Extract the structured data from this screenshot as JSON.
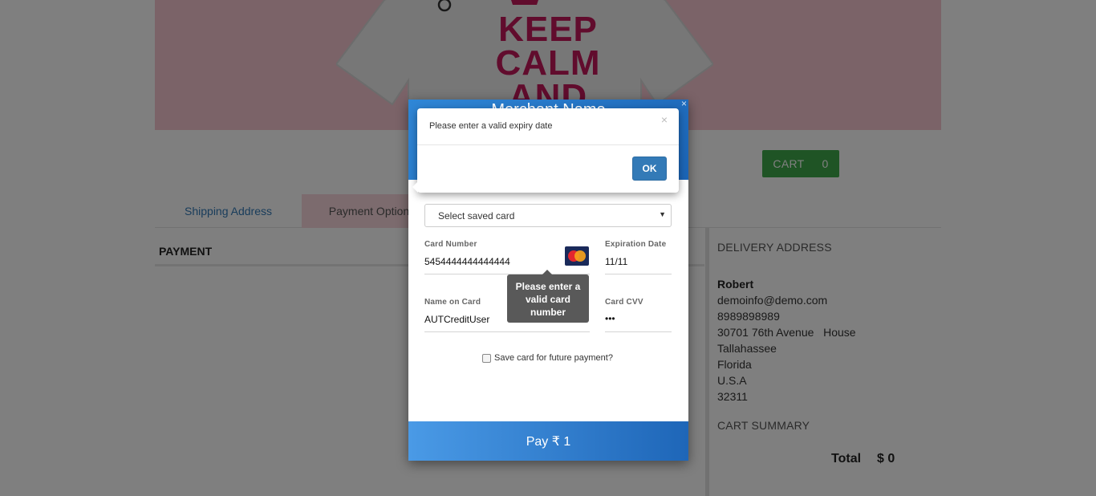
{
  "hero": {
    "shirt_text": [
      "KEEP",
      "CALM",
      "AND"
    ]
  },
  "cart": {
    "label": "CART",
    "count": "0"
  },
  "tabs": [
    {
      "label": "Shipping Address"
    },
    {
      "label": "Payment Option"
    }
  ],
  "left": {
    "payment_heading": "PAYMENT"
  },
  "right": {
    "delivery_heading": "DELIVERY ADDRESS",
    "address": {
      "name": "Robert",
      "email": "demoinfo@demo.com",
      "phone": "8989898989",
      "street": "30701 76th Avenue   House",
      "city": "Tallahassee",
      "state": "Florida",
      "country": "U.S.A",
      "zip": "32311"
    },
    "cart_summary_heading": "CART SUMMARY",
    "total_label": "Total",
    "total_value": "$ 0"
  },
  "payment_modal": {
    "merchant_name": "Merchant Name",
    "close": "×",
    "saved_card_placeholder": "Select saved card",
    "card_number_label": "Card Number",
    "card_number_value": "5454444444444444",
    "expiry_label": "Expiration Date",
    "expiry_value": "11/11",
    "name_label": "Name on Card",
    "name_value": "AUTCreditUser",
    "cvv_label": "Card CVV",
    "cvv_value": "•••",
    "card_tooltip": "Please enter a valid card number",
    "save_card_label": "Save card for future payment?",
    "pay_button": "Pay ₹ 1"
  },
  "alert": {
    "message": "Please enter a valid expiry date",
    "close": "×",
    "ok_button": "OK"
  },
  "colors": {
    "accent_blue": "#337ab7",
    "cart_green": "#3fa94a",
    "hero_pink": "#f6c7d0",
    "shirt_text": "#c2185b"
  }
}
